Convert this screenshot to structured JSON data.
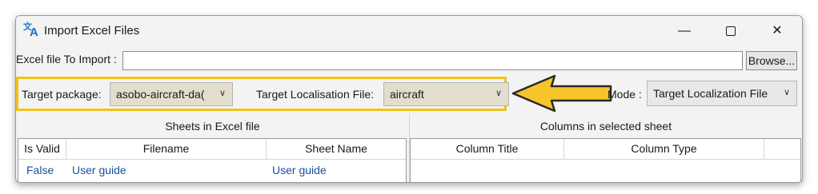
{
  "window": {
    "title": "Import Excel Files",
    "icon": "translate-icon"
  },
  "file_row": {
    "label": "Excel file To Import :",
    "value": "",
    "browse_label": "Browse..."
  },
  "targets": {
    "package_label": "Target package:",
    "package_value": "asobo-aircraft-da(",
    "loc_file_label": "Target Localisation File:",
    "loc_file_value": "aircraft",
    "mode_label": "Mode :",
    "mode_value": "Target Localization File"
  },
  "sheets_pane": {
    "title": "Sheets in Excel file",
    "columns": [
      "Is Valid",
      "Filename",
      "Sheet Name"
    ],
    "rows": [
      {
        "is_valid": "False",
        "filename": "User guide",
        "sheet_name": "User guide"
      }
    ]
  },
  "columns_pane": {
    "title": "Columns in selected sheet",
    "columns": [
      "Column Title",
      "Column Type"
    ]
  },
  "colors": {
    "highlight": "#f2c318",
    "arrow_fill": "#f7c52a",
    "link_text": "#1a4f9c"
  }
}
